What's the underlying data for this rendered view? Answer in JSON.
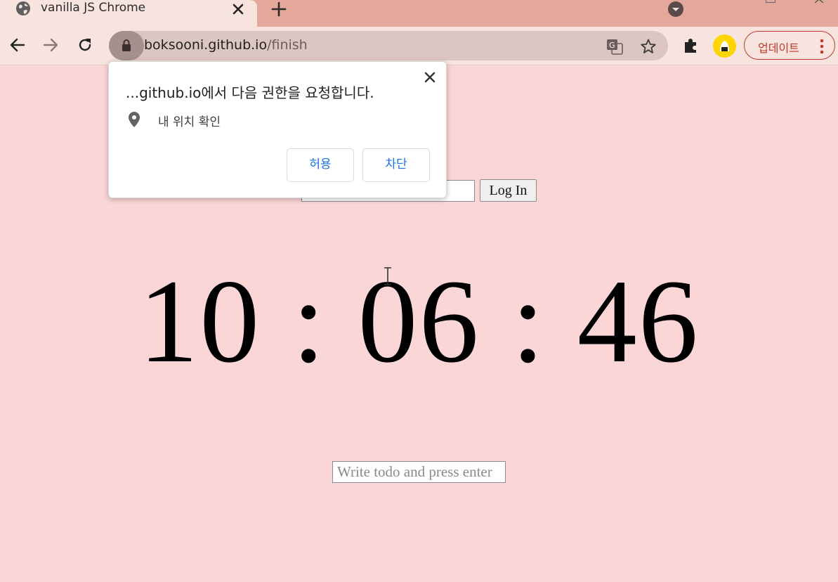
{
  "browser": {
    "tab": {
      "title": "vanilla JS Chrome"
    },
    "omnibox": {
      "host": "boksooni.github.io",
      "path": "/finish"
    },
    "update_label": "업데이트"
  },
  "permission_popup": {
    "title": "...github.io에서 다음 권한을 요청합니다.",
    "permission": "내 위치 확인",
    "allow_label": "허용",
    "block_label": "차단"
  },
  "page": {
    "login_button": "Log In",
    "clock": "10 : 06 : 46",
    "todo_placeholder": "Write todo and press enter"
  },
  "colors": {
    "page_background": "#fad6d6",
    "tabstrip": "#e3a899",
    "update_accent": "#c0392b"
  }
}
